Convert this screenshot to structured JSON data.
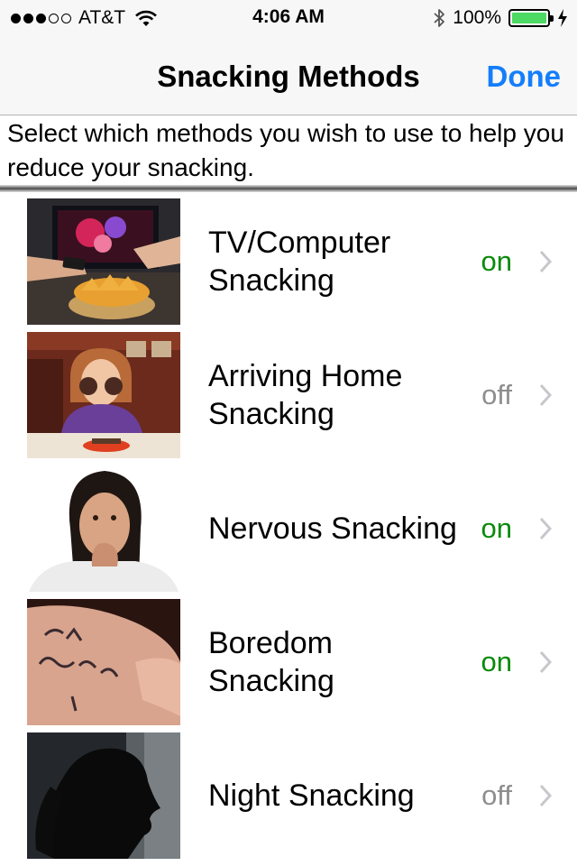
{
  "status_bar": {
    "carrier": "AT&T",
    "time": "4:06 AM",
    "battery": "100%",
    "signal_bars": 3,
    "signal_total": 5
  },
  "nav": {
    "title": "Snacking Methods",
    "done_label": "Done",
    "accent_color": "#147efb"
  },
  "instructions": "Select which methods you wish to use to help you reduce your snacking.",
  "methods": [
    {
      "label": "TV/Computer\nSnacking",
      "status": "on",
      "image": "tv-snacking-photo"
    },
    {
      "label": "Arriving Home\nSnacking",
      "status": "off",
      "image": "girl-eating-cookies-photo"
    },
    {
      "label": "Nervous Snacking",
      "status": "on",
      "image": "nervous-girl-photo"
    },
    {
      "label": "Boredom\nSnacking",
      "status": "on",
      "image": "i-am-bored-hand-photo"
    },
    {
      "label": "Night Snacking",
      "status": "off",
      "image": "night-silhouette-photo"
    }
  ],
  "status_colors": {
    "on": "#0a8a0a",
    "off": "#8e8e8e"
  }
}
